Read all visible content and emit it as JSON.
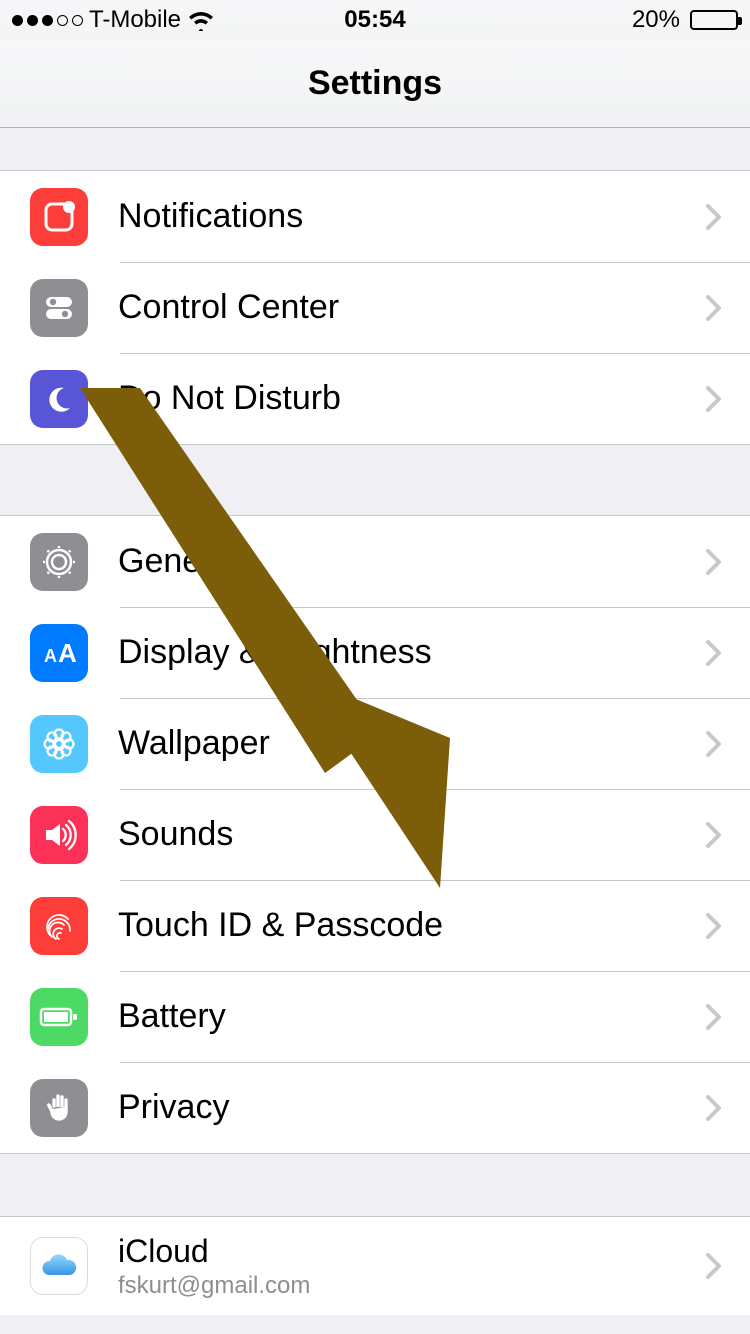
{
  "status": {
    "carrier": "T-Mobile",
    "time": "05:54",
    "battery_pct": "20%",
    "battery_level": 0.2
  },
  "nav": {
    "title": "Settings"
  },
  "sections": [
    {
      "rows": [
        {
          "id": "notifications",
          "label": "Notifications",
          "icon": "notifications-icon"
        },
        {
          "id": "control-center",
          "label": "Control Center",
          "icon": "control-center-icon"
        },
        {
          "id": "dnd",
          "label": "Do Not Disturb",
          "icon": "moon-icon"
        }
      ]
    },
    {
      "rows": [
        {
          "id": "general",
          "label": "General",
          "icon": "gear-icon"
        },
        {
          "id": "display",
          "label": "Display & Brightness",
          "icon": "text-size-icon"
        },
        {
          "id": "wallpaper",
          "label": "Wallpaper",
          "icon": "flower-icon"
        },
        {
          "id": "sounds",
          "label": "Sounds",
          "icon": "speaker-icon"
        },
        {
          "id": "touchid",
          "label": "Touch ID & Passcode",
          "icon": "fingerprint-icon"
        },
        {
          "id": "battery",
          "label": "Battery",
          "icon": "battery-icon"
        },
        {
          "id": "privacy",
          "label": "Privacy",
          "icon": "hand-icon"
        }
      ]
    },
    {
      "rows": [
        {
          "id": "icloud",
          "label": "iCloud",
          "sub": "fskurt@gmail.com",
          "icon": "cloud-icon"
        }
      ]
    }
  ],
  "annotation": {
    "color": "#7b5d0a"
  }
}
